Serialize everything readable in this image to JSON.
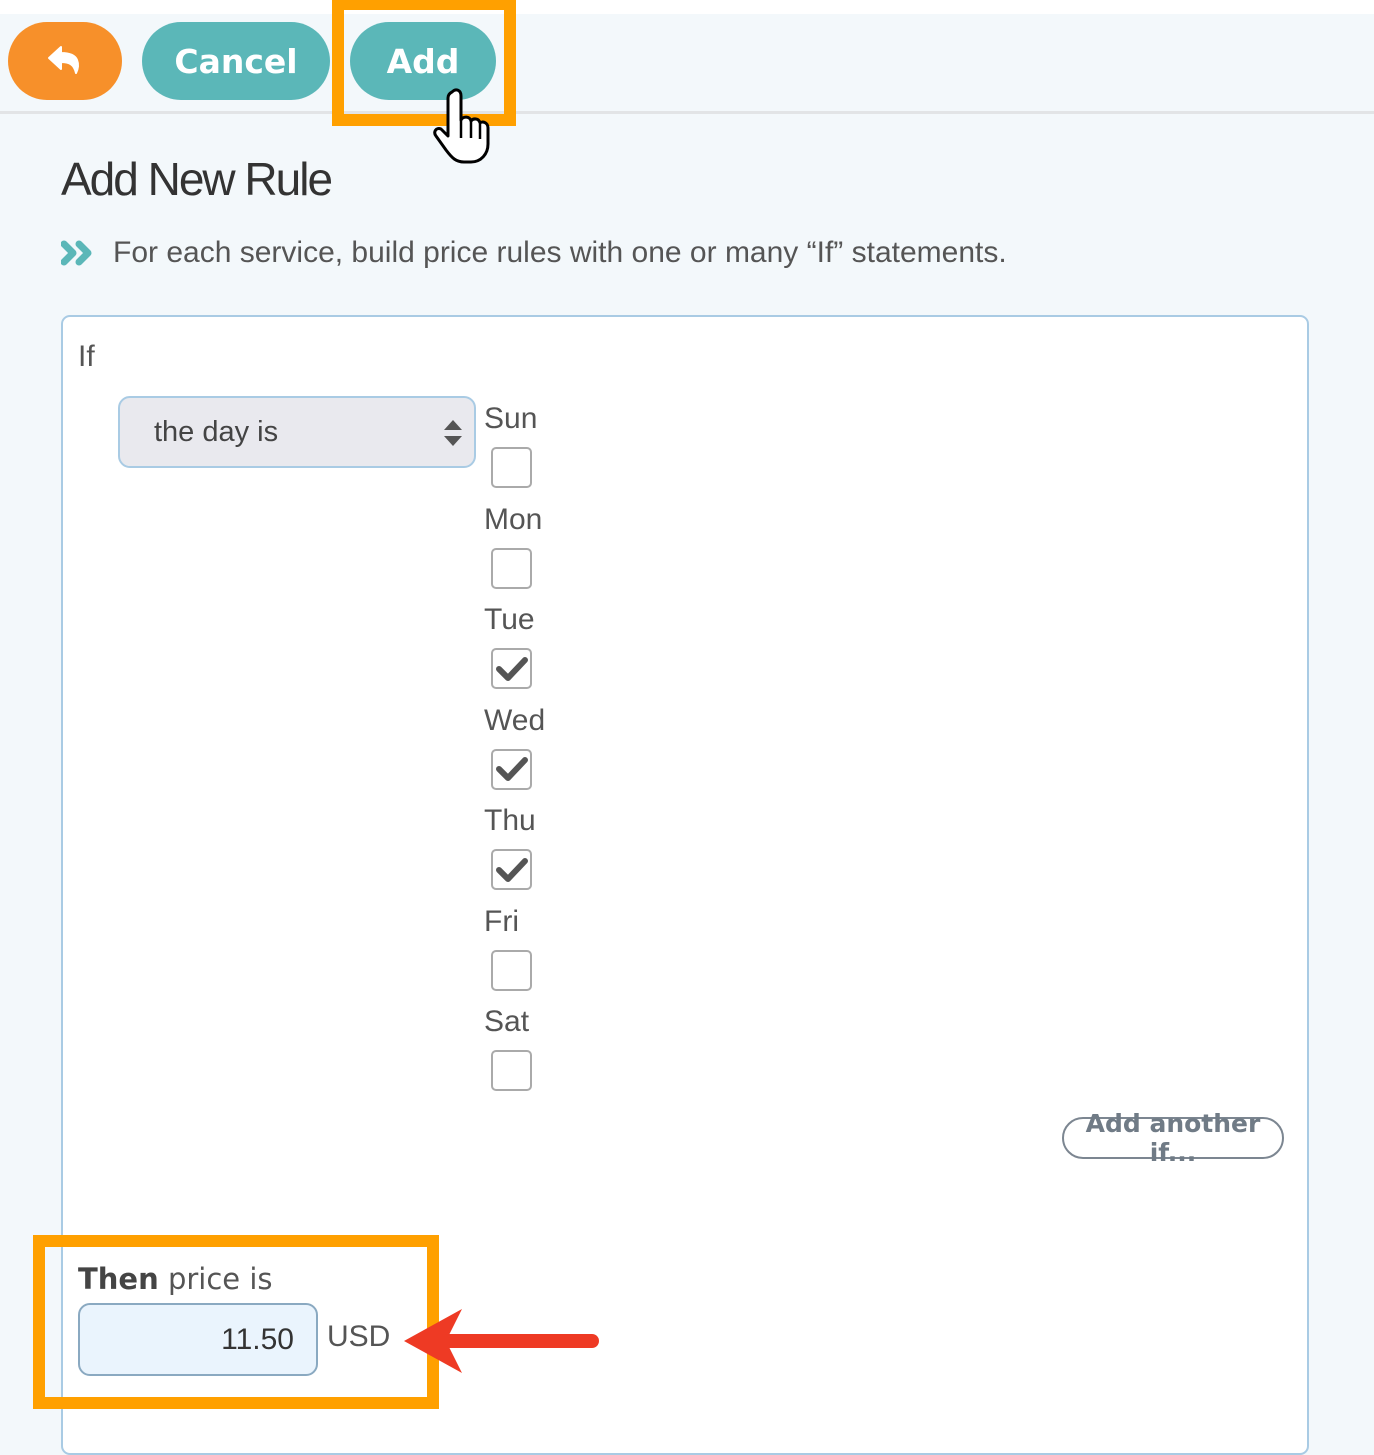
{
  "toolbar": {
    "back_icon": "reply-arrow-icon",
    "cancel_label": "Cancel",
    "add_label": "Add"
  },
  "header": {
    "title": "Add New Rule",
    "subtitle_icon": "double-chevron-right-icon",
    "subtitle": "For each service, build price rules with one or many “If” statements."
  },
  "rule": {
    "if_label": "If",
    "condition_select": {
      "selected": "the day is"
    },
    "days": [
      {
        "label": "Sun",
        "checked": false
      },
      {
        "label": "Mon",
        "checked": false
      },
      {
        "label": "Tue",
        "checked": true
      },
      {
        "label": "Wed",
        "checked": true
      },
      {
        "label": "Thu",
        "checked": true
      },
      {
        "label": "Fri",
        "checked": false
      },
      {
        "label": "Sat",
        "checked": false
      }
    ],
    "add_another_label": "Add another if...",
    "then_bold": "Then",
    "then_rest": " price is",
    "price_value": "11.50",
    "currency": "USD"
  },
  "colors": {
    "back_button": "#f7902a",
    "primary_button": "#5bb7b8",
    "highlight": "#ffa000",
    "annotation_arrow": "#ee3a24"
  }
}
